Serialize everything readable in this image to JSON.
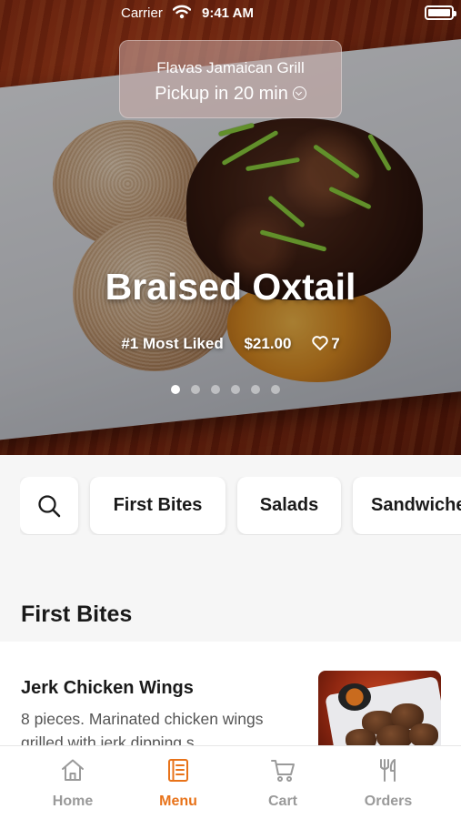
{
  "status_bar": {
    "carrier": "Carrier",
    "time": "9:41 AM"
  },
  "restaurant": {
    "name": "Flavas Jamaican Grill",
    "pickup": "Pickup in 20 min"
  },
  "featured": {
    "title": "Braised Oxtail",
    "badge": "#1 Most Liked",
    "price": "$21.00",
    "likes": "7",
    "carousel_count": 6,
    "carousel_active": 0
  },
  "categories": [
    {
      "label": "First Bites"
    },
    {
      "label": "Salads"
    },
    {
      "label": "Sandwiches"
    }
  ],
  "section": {
    "title": "First Bites"
  },
  "menu_items": [
    {
      "name": "Jerk Chicken Wings",
      "description": "8 pieces. Marinated chicken wings grilled with jerk dipping s..."
    }
  ],
  "tabs": [
    {
      "label": "Home",
      "icon": "home-icon",
      "active": false
    },
    {
      "label": "Menu",
      "icon": "menu-book-icon",
      "active": true
    },
    {
      "label": "Cart",
      "icon": "cart-icon",
      "active": false
    },
    {
      "label": "Orders",
      "icon": "utensils-icon",
      "active": false
    }
  ],
  "colors": {
    "accent": "#e8731a",
    "inactive": "#9a9a9a"
  }
}
